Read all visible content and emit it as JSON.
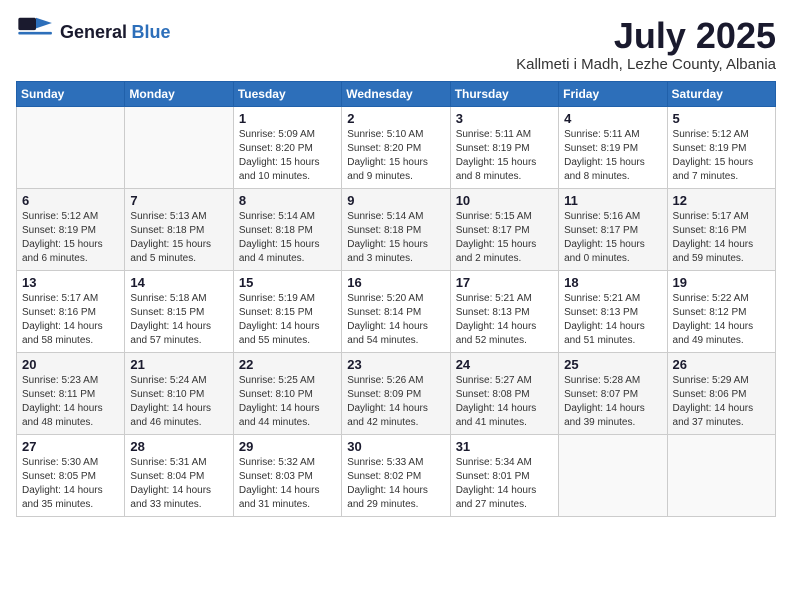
{
  "logo": {
    "general": "General",
    "blue": "Blue"
  },
  "header": {
    "month": "July 2025",
    "location": "Kallmeti i Madh, Lezhe County, Albania"
  },
  "weekdays": [
    "Sunday",
    "Monday",
    "Tuesday",
    "Wednesday",
    "Thursday",
    "Friday",
    "Saturday"
  ],
  "weeks": [
    [
      {
        "day": "",
        "info": ""
      },
      {
        "day": "",
        "info": ""
      },
      {
        "day": "1",
        "info": "Sunrise: 5:09 AM\nSunset: 8:20 PM\nDaylight: 15 hours\nand 10 minutes."
      },
      {
        "day": "2",
        "info": "Sunrise: 5:10 AM\nSunset: 8:20 PM\nDaylight: 15 hours\nand 9 minutes."
      },
      {
        "day": "3",
        "info": "Sunrise: 5:11 AM\nSunset: 8:19 PM\nDaylight: 15 hours\nand 8 minutes."
      },
      {
        "day": "4",
        "info": "Sunrise: 5:11 AM\nSunset: 8:19 PM\nDaylight: 15 hours\nand 8 minutes."
      },
      {
        "day": "5",
        "info": "Sunrise: 5:12 AM\nSunset: 8:19 PM\nDaylight: 15 hours\nand 7 minutes."
      }
    ],
    [
      {
        "day": "6",
        "info": "Sunrise: 5:12 AM\nSunset: 8:19 PM\nDaylight: 15 hours\nand 6 minutes."
      },
      {
        "day": "7",
        "info": "Sunrise: 5:13 AM\nSunset: 8:18 PM\nDaylight: 15 hours\nand 5 minutes."
      },
      {
        "day": "8",
        "info": "Sunrise: 5:14 AM\nSunset: 8:18 PM\nDaylight: 15 hours\nand 4 minutes."
      },
      {
        "day": "9",
        "info": "Sunrise: 5:14 AM\nSunset: 8:18 PM\nDaylight: 15 hours\nand 3 minutes."
      },
      {
        "day": "10",
        "info": "Sunrise: 5:15 AM\nSunset: 8:17 PM\nDaylight: 15 hours\nand 2 minutes."
      },
      {
        "day": "11",
        "info": "Sunrise: 5:16 AM\nSunset: 8:17 PM\nDaylight: 15 hours\nand 0 minutes."
      },
      {
        "day": "12",
        "info": "Sunrise: 5:17 AM\nSunset: 8:16 PM\nDaylight: 14 hours\nand 59 minutes."
      }
    ],
    [
      {
        "day": "13",
        "info": "Sunrise: 5:17 AM\nSunset: 8:16 PM\nDaylight: 14 hours\nand 58 minutes."
      },
      {
        "day": "14",
        "info": "Sunrise: 5:18 AM\nSunset: 8:15 PM\nDaylight: 14 hours\nand 57 minutes."
      },
      {
        "day": "15",
        "info": "Sunrise: 5:19 AM\nSunset: 8:15 PM\nDaylight: 14 hours\nand 55 minutes."
      },
      {
        "day": "16",
        "info": "Sunrise: 5:20 AM\nSunset: 8:14 PM\nDaylight: 14 hours\nand 54 minutes."
      },
      {
        "day": "17",
        "info": "Sunrise: 5:21 AM\nSunset: 8:13 PM\nDaylight: 14 hours\nand 52 minutes."
      },
      {
        "day": "18",
        "info": "Sunrise: 5:21 AM\nSunset: 8:13 PM\nDaylight: 14 hours\nand 51 minutes."
      },
      {
        "day": "19",
        "info": "Sunrise: 5:22 AM\nSunset: 8:12 PM\nDaylight: 14 hours\nand 49 minutes."
      }
    ],
    [
      {
        "day": "20",
        "info": "Sunrise: 5:23 AM\nSunset: 8:11 PM\nDaylight: 14 hours\nand 48 minutes."
      },
      {
        "day": "21",
        "info": "Sunrise: 5:24 AM\nSunset: 8:10 PM\nDaylight: 14 hours\nand 46 minutes."
      },
      {
        "day": "22",
        "info": "Sunrise: 5:25 AM\nSunset: 8:10 PM\nDaylight: 14 hours\nand 44 minutes."
      },
      {
        "day": "23",
        "info": "Sunrise: 5:26 AM\nSunset: 8:09 PM\nDaylight: 14 hours\nand 42 minutes."
      },
      {
        "day": "24",
        "info": "Sunrise: 5:27 AM\nSunset: 8:08 PM\nDaylight: 14 hours\nand 41 minutes."
      },
      {
        "day": "25",
        "info": "Sunrise: 5:28 AM\nSunset: 8:07 PM\nDaylight: 14 hours\nand 39 minutes."
      },
      {
        "day": "26",
        "info": "Sunrise: 5:29 AM\nSunset: 8:06 PM\nDaylight: 14 hours\nand 37 minutes."
      }
    ],
    [
      {
        "day": "27",
        "info": "Sunrise: 5:30 AM\nSunset: 8:05 PM\nDaylight: 14 hours\nand 35 minutes."
      },
      {
        "day": "28",
        "info": "Sunrise: 5:31 AM\nSunset: 8:04 PM\nDaylight: 14 hours\nand 33 minutes."
      },
      {
        "day": "29",
        "info": "Sunrise: 5:32 AM\nSunset: 8:03 PM\nDaylight: 14 hours\nand 31 minutes."
      },
      {
        "day": "30",
        "info": "Sunrise: 5:33 AM\nSunset: 8:02 PM\nDaylight: 14 hours\nand 29 minutes."
      },
      {
        "day": "31",
        "info": "Sunrise: 5:34 AM\nSunset: 8:01 PM\nDaylight: 14 hours\nand 27 minutes."
      },
      {
        "day": "",
        "info": ""
      },
      {
        "day": "",
        "info": ""
      }
    ]
  ]
}
